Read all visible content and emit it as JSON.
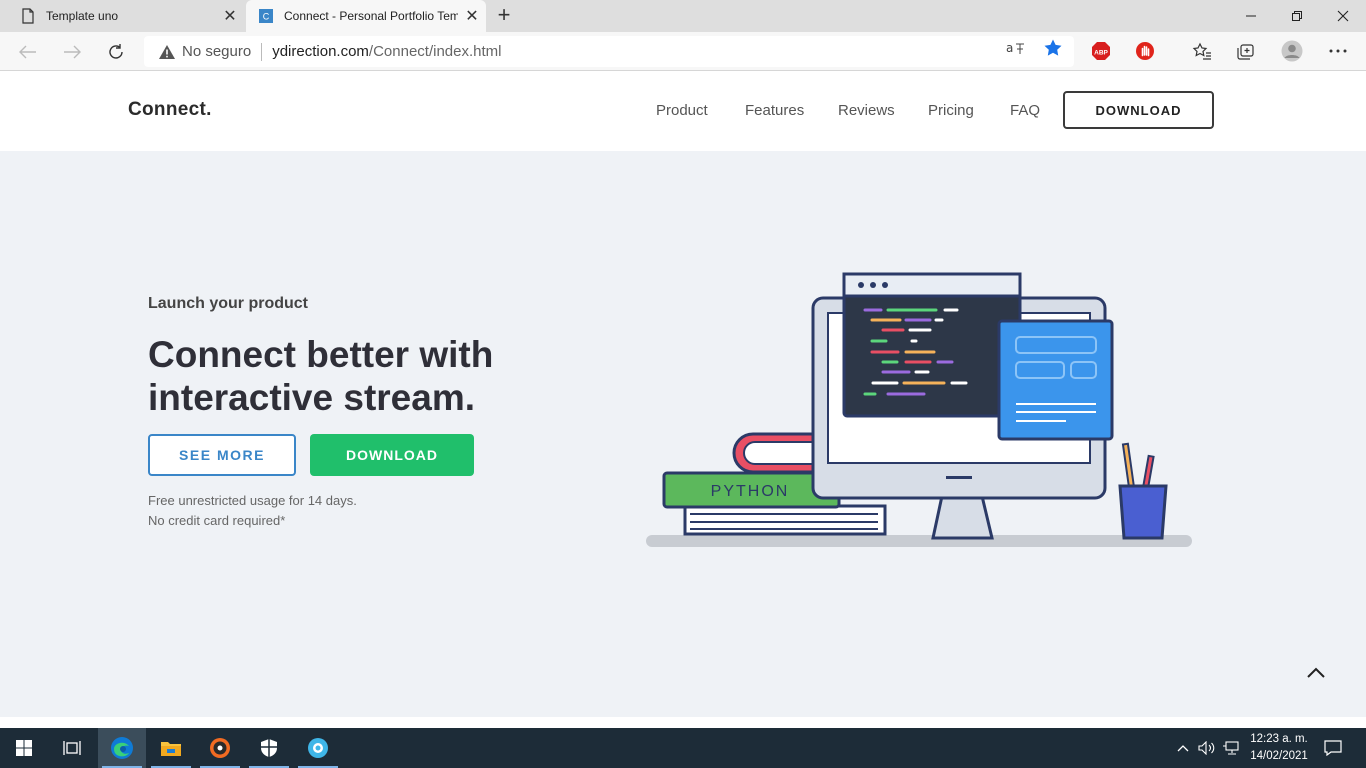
{
  "browser": {
    "tabs": [
      {
        "title": "Template uno",
        "active": false
      },
      {
        "title": "Connect - Personal Portfolio Tem",
        "active": true
      }
    ],
    "address": {
      "security_label": "No seguro",
      "domain": "ydirection.com",
      "path": "/Connect/index.html"
    },
    "tab_favicon_letter": "C",
    "ext_abp_label": "ABP"
  },
  "site": {
    "brand": "Connect.",
    "nav": [
      "Product",
      "Features",
      "Reviews",
      "Pricing",
      "FAQ"
    ],
    "nav_cta": "DOWNLOAD",
    "hero": {
      "eyebrow": "Launch your product",
      "headline": "Connect better with interactive stream.",
      "btn_secondary": "SEE MORE",
      "btn_primary": "DOWNLOAD",
      "fine_print_1": "Free unrestricted usage for 14 days.",
      "fine_print_2": "No credit card required*",
      "book_label": "PYTHON"
    },
    "colors": {
      "accent_green": "#20bf6b",
      "accent_blue": "#3a86c8",
      "hero_bg": "#eff2f6"
    }
  },
  "taskbar": {
    "time": "12:23 a. m.",
    "date": "14/02/2021",
    "apps": [
      "start-icon",
      "task-view-icon",
      "edge-icon",
      "file-explorer-icon",
      "media-icon",
      "security-icon",
      "app-icon"
    ]
  }
}
